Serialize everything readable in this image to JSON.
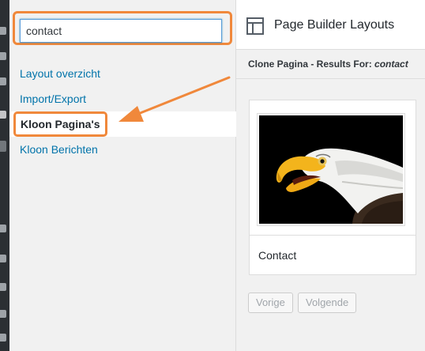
{
  "search": {
    "value": "contact"
  },
  "nav": {
    "items": [
      {
        "label": "Layout overzicht"
      },
      {
        "label": "Import/Export"
      },
      {
        "label": "Kloon Pagina's",
        "active": true
      },
      {
        "label": "Kloon Berichten"
      }
    ]
  },
  "header": {
    "title": "Page Builder Layouts",
    "icon": "layout-icon"
  },
  "results": {
    "prefix": "Clone Pagina - Results For: ",
    "query": "contact"
  },
  "card": {
    "title": "Contact",
    "thumbnail": "bald-eagle-photo"
  },
  "pagination": {
    "prev": "Vorige",
    "next": "Volgende"
  },
  "colors": {
    "accent_orange": "#f0883b",
    "link": "#0073aa",
    "admin_bar": "#23282d"
  }
}
